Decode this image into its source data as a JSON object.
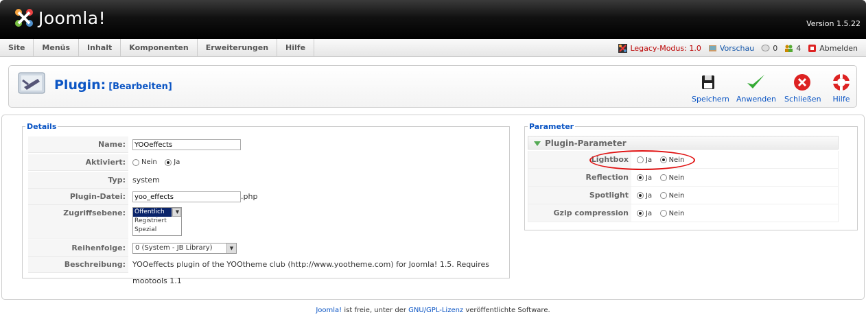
{
  "header": {
    "logo_text": "Joomla!",
    "version": "Version 1.5.22"
  },
  "menu": {
    "items": [
      "Site",
      "Menüs",
      "Inhalt",
      "Komponenten",
      "Erweiterungen",
      "Hilfe"
    ]
  },
  "status": {
    "legacy": "Legacy-Modus: 1.0",
    "preview": "Vorschau",
    "messages": "0",
    "users": "4",
    "logout": "Abmelden"
  },
  "toolbar": {
    "title": "Plugin:",
    "subtitle": "[Bearbeiten]",
    "buttons": {
      "save": "Speichern",
      "apply": "Anwenden",
      "close": "Schließen",
      "help": "Hilfe"
    }
  },
  "details": {
    "legend": "Details",
    "name_label": "Name:",
    "name_value": "YOOeffects",
    "enabled_label": "Aktiviert:",
    "enabled_no": "Nein",
    "enabled_yes": "Ja",
    "type_label": "Typ:",
    "type_value": "system",
    "file_label": "Plugin-Datei:",
    "file_value": "yoo_effects",
    "file_ext": ".php",
    "access_label": "Zugriffsebene:",
    "access_options": [
      "Öffentlich",
      "Registriert",
      "Spezial"
    ],
    "order_label": "Reihenfolge:",
    "order_value": "0 (System - JB Library)",
    "desc_label": "Beschreibung:",
    "desc_value": "YOOeffects plugin of the YOOtheme club (http://www.yootheme.com) for Joomla! 1.5. Requires mootools 1.1"
  },
  "params": {
    "legend": "Parameter",
    "header": "Plugin-Parameter",
    "rows": [
      {
        "label": "Lightbox",
        "yes": "Ja",
        "no": "Nein",
        "selected": "no"
      },
      {
        "label": "Reflection",
        "yes": "Ja",
        "no": "Nein",
        "selected": "yes"
      },
      {
        "label": "Spotlight",
        "yes": "Ja",
        "no": "Nein",
        "selected": "yes"
      },
      {
        "label": "Gzip compression",
        "yes": "Ja",
        "no": "Nein",
        "selected": "yes"
      }
    ]
  },
  "footer": {
    "link1": "Joomla!",
    "text1": " ist freie, unter der ",
    "link2": "GNU/GPL-Lizenz",
    "text2": " veröffentlichte Software."
  }
}
